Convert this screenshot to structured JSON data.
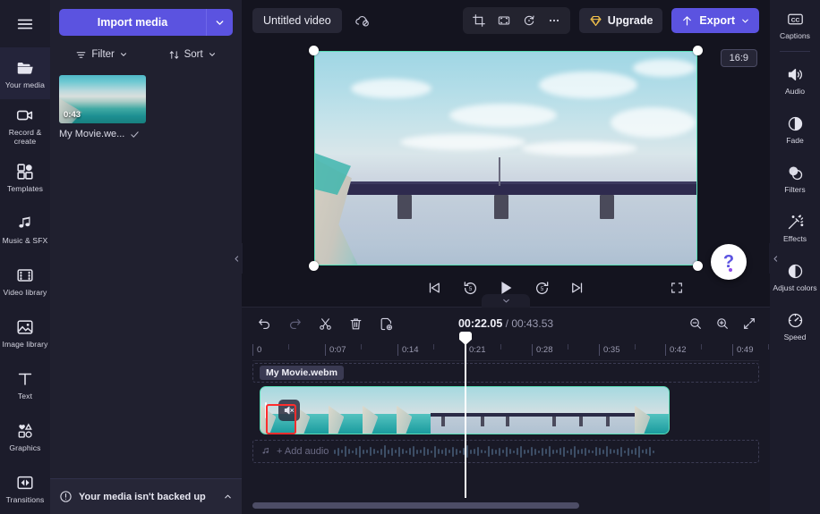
{
  "left_rail": {
    "menu_icon": "hamburger-menu-icon",
    "items": [
      {
        "label": "Your media",
        "icon": "folder-icon",
        "active": true
      },
      {
        "label": "Record & create",
        "icon": "camera-icon",
        "active": false
      },
      {
        "label": "Templates",
        "icon": "templates-icon",
        "active": false
      },
      {
        "label": "Music & SFX",
        "icon": "music-note-icon",
        "active": false
      },
      {
        "label": "Video library",
        "icon": "film-strip-icon",
        "active": false
      },
      {
        "label": "Image library",
        "icon": "image-icon",
        "active": false
      },
      {
        "label": "Text",
        "icon": "text-t-icon",
        "active": false
      },
      {
        "label": "Graphics",
        "icon": "shapes-icon",
        "active": false
      },
      {
        "label": "Transitions",
        "icon": "transitions-icon",
        "active": false
      }
    ]
  },
  "media_panel": {
    "import_label": "Import media",
    "import_caret_icon": "chevron-down-icon",
    "filter_label": "Filter",
    "filter_icon": "filter-icon",
    "sort_label": "Sort",
    "sort_icon": "sort-arrows-icon",
    "collapse_icon": "chevron-left-icon",
    "media_items": [
      {
        "name": "My Movie.we...",
        "duration": "0:43",
        "checked": true
      }
    ],
    "backup_notice": "Your media isn't backed up",
    "backup_icon": "warning-circle-icon",
    "backup_caret_icon": "chevron-up-icon"
  },
  "topbar": {
    "project_title": "Untitled video",
    "project_title_placeholder": "Untitled video",
    "cloud_icon": "cloud-off-icon",
    "tools": [
      {
        "icon": "crop-icon",
        "name": "crop"
      },
      {
        "icon": "fit-to-frame-icon",
        "name": "fit"
      },
      {
        "icon": "rotate-icon",
        "name": "rotate"
      },
      {
        "icon": "more-horizontal-icon",
        "name": "more"
      }
    ],
    "upgrade_label": "Upgrade",
    "upgrade_icon": "diamond-icon",
    "export_label": "Export",
    "export_icon": "upload-arrow-icon",
    "export_caret_icon": "chevron-down-icon"
  },
  "stage": {
    "aspect_ratio": "16:9",
    "collapse_icon": "chevron-down-icon",
    "help_label": "?",
    "player_controls": [
      {
        "name": "skip-to-start",
        "icon": "skip-start-icon"
      },
      {
        "name": "rewind-5s",
        "icon": "rewind-5-icon"
      },
      {
        "name": "play",
        "icon": "play-icon"
      },
      {
        "name": "forward-5s",
        "icon": "forward-5-icon"
      },
      {
        "name": "skip-to-end",
        "icon": "skip-end-icon"
      }
    ],
    "fullscreen_icon": "fullscreen-icon"
  },
  "timeline": {
    "tools": [
      {
        "name": "undo",
        "icon": "undo-icon"
      },
      {
        "name": "redo",
        "icon": "redo-icon"
      },
      {
        "name": "split",
        "icon": "scissors-icon"
      },
      {
        "name": "delete",
        "icon": "trash-icon"
      },
      {
        "name": "duplicate",
        "icon": "duplicate-icon"
      }
    ],
    "current_time": "00:22.05",
    "separator": " / ",
    "total_time": "00:43.53",
    "zoom_out_icon": "zoom-out-icon",
    "zoom_in_icon": "zoom-in-icon",
    "fit_icon": "fit-timeline-icon",
    "ruler_ticks": [
      "0",
      "0:07",
      "0:14",
      "0:21",
      "0:28",
      "0:35",
      "0:42",
      "0:49"
    ],
    "clip_label": "My Movie.webm",
    "clip_mute_icon": "speaker-mute-icon",
    "add_audio_label": "+ Add audio",
    "add_audio_icon": "music-note-icon"
  },
  "right_rail": {
    "items": [
      {
        "label": "Captions",
        "icon": "captions-cc-icon"
      },
      {
        "label": "Audio",
        "icon": "speaker-icon"
      },
      {
        "label": "Fade",
        "icon": "fade-icon"
      },
      {
        "label": "Filters",
        "icon": "filters-icon"
      },
      {
        "label": "Effects",
        "icon": "magic-wand-icon"
      },
      {
        "label": "Adjust colors",
        "icon": "contrast-icon"
      },
      {
        "label": "Speed",
        "icon": "speedometer-icon"
      }
    ],
    "collapse_icon": "chevron-left-icon"
  },
  "colors": {
    "accent": "#5b53e0",
    "clip_border": "#5ae0b8",
    "highlight": "#ff2d2d",
    "panel_bg": "#20202f",
    "rail_bg": "#1c1c2b"
  }
}
